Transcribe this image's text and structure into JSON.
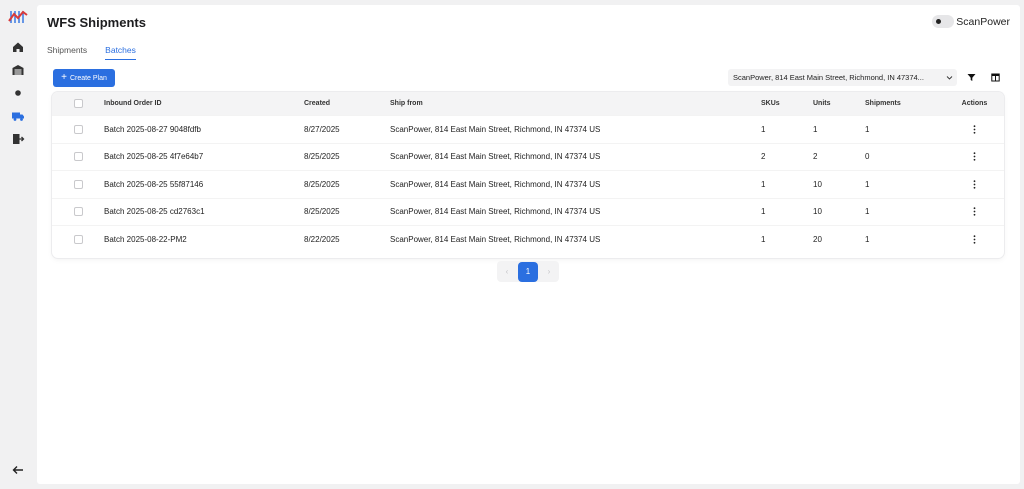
{
  "app": {
    "title": "WFS Shipments",
    "brand": "ScanPower"
  },
  "colors": {
    "accent": "#2b6fe0",
    "logo_red": "#d93a3a",
    "logo_blue": "#2b6fe0"
  },
  "sidebar": {
    "items": [
      {
        "icon": "home-icon"
      },
      {
        "icon": "warehouse-icon"
      },
      {
        "icon": "dot-icon"
      },
      {
        "icon": "truck-icon"
      },
      {
        "icon": "logout-icon"
      }
    ],
    "collapse_icon": "arrow-left-icon"
  },
  "tabs": [
    {
      "label": "Shipments",
      "active": false
    },
    {
      "label": "Batches",
      "active": true
    }
  ],
  "toolbar": {
    "create_plan_label": "Create Plan",
    "address_value": "ScanPower, 814 East Main Street, Richmond, IN 47374..."
  },
  "table": {
    "columns": [
      "Inbound Order ID",
      "Created",
      "Ship from",
      "SKUs",
      "Units",
      "Shipments",
      "Actions"
    ],
    "rows": [
      {
        "id": "Batch 2025-08-27 9048fdfb",
        "created": "8/27/2025",
        "ship_from": "ScanPower, 814 East Main Street, Richmond, IN 47374 US",
        "skus": "1",
        "units": "1",
        "shipments": "1"
      },
      {
        "id": "Batch 2025-08-25 4f7e64b7",
        "created": "8/25/2025",
        "ship_from": "ScanPower, 814 East Main Street, Richmond, IN 47374 US",
        "skus": "2",
        "units": "2",
        "shipments": "0"
      },
      {
        "id": "Batch 2025-08-25 55f87146",
        "created": "8/25/2025",
        "ship_from": "ScanPower, 814 East Main Street, Richmond, IN 47374 US",
        "skus": "1",
        "units": "10",
        "shipments": "1"
      },
      {
        "id": "Batch 2025-08-25 cd2763c1",
        "created": "8/25/2025",
        "ship_from": "ScanPower, 814 East Main Street, Richmond, IN 47374 US",
        "skus": "1",
        "units": "10",
        "shipments": "1"
      },
      {
        "id": "Batch 2025-08-22-PM2",
        "created": "8/22/2025",
        "ship_from": "ScanPower, 814 East Main Street, Richmond, IN 47374 US",
        "skus": "1",
        "units": "20",
        "shipments": "1"
      }
    ]
  },
  "pagination": {
    "current_page": "1",
    "prev": "‹",
    "next": "›"
  }
}
